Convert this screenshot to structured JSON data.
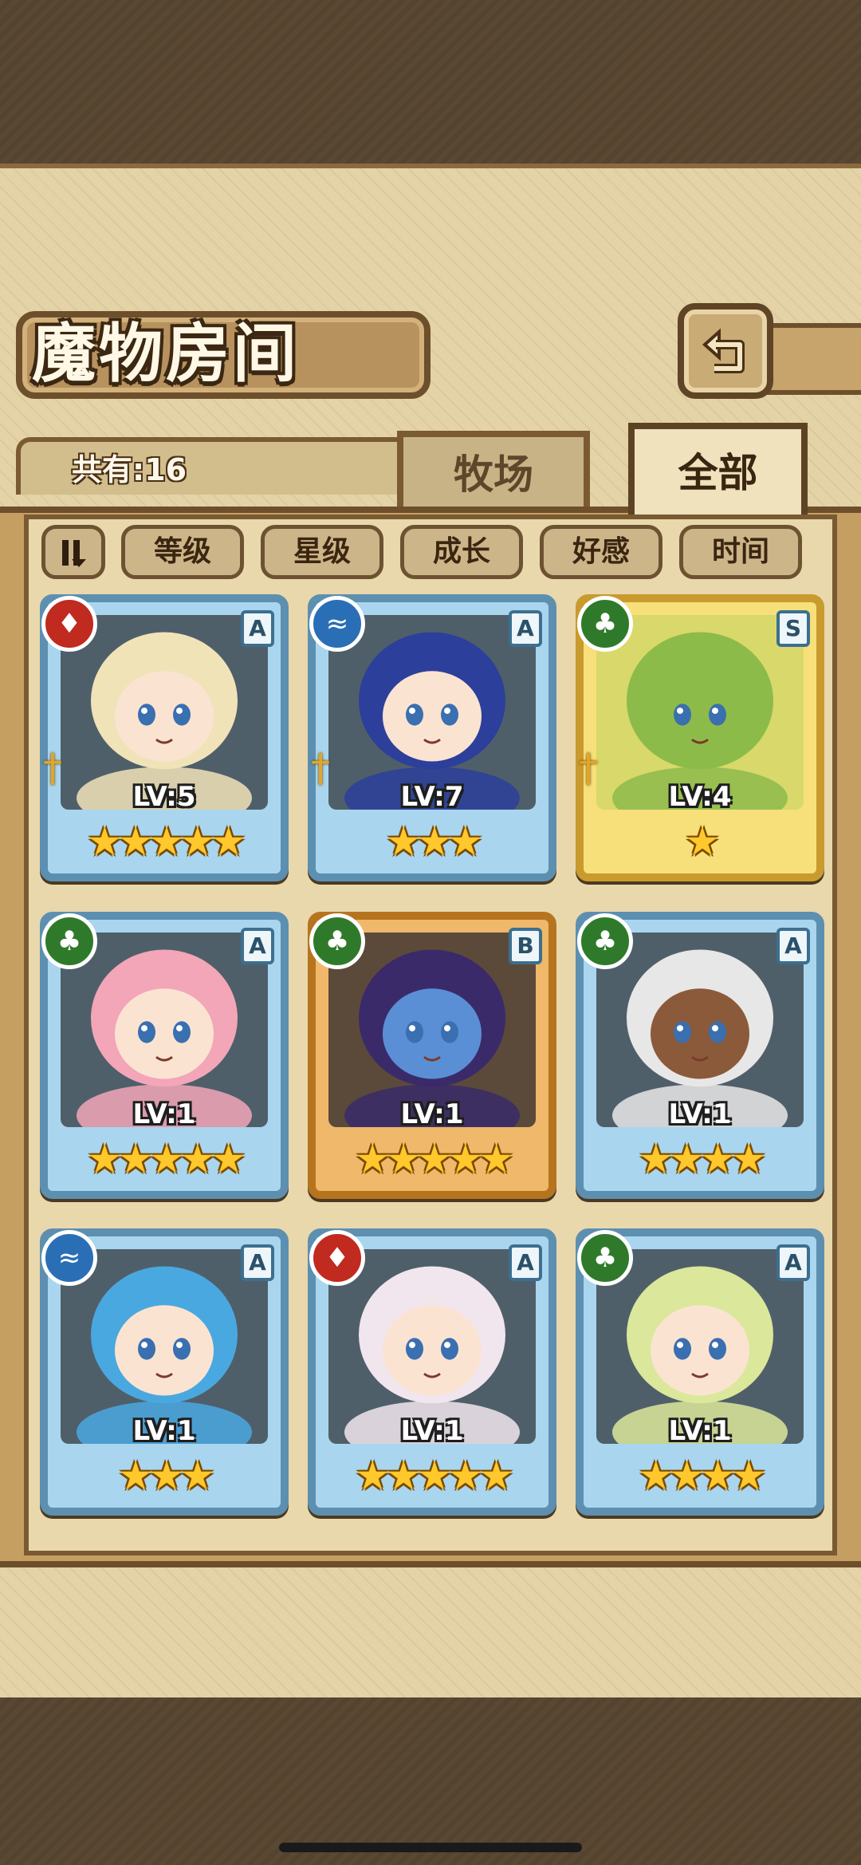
{
  "screen": {
    "title": "魔物房间",
    "count_label": "共有:16",
    "back_icon": "back-arrow-icon"
  },
  "tabs": [
    {
      "label": "牧场",
      "selected": false
    },
    {
      "label": "全部",
      "selected": true
    }
  ],
  "sort": {
    "toggle_icon": "sort-toggle-icon",
    "buttons": [
      "等级",
      "星级",
      "成长",
      "好感",
      "时间"
    ]
  },
  "colors": {
    "fire": "#c02a1f",
    "water": "#2a6fb6",
    "nature": "#2f7a2a",
    "frame_blue": "#5d8fb0",
    "frame_gold": "#c99a2e",
    "frame_bronze": "#b7741f"
  },
  "monsters": [
    {
      "level": "LV:5",
      "element": "fire",
      "rank": "A",
      "stars": 5,
      "frame": "blue",
      "weapon_icon": "sword-icon",
      "portrait_icon": "blonde-girl-portrait"
    },
    {
      "level": "LV:7",
      "element": "water",
      "rank": "A",
      "stars": 3,
      "frame": "blue",
      "weapon_icon": "sword-icon",
      "portrait_icon": "blue-cat-girl-portrait"
    },
    {
      "level": "LV:4",
      "element": "nature",
      "rank": "S",
      "stars": 1,
      "frame": "gold",
      "weapon_icon": "sword-icon",
      "portrait_icon": "green-slime-portrait"
    },
    {
      "level": "LV:1",
      "element": "nature",
      "rank": "A",
      "stars": 5,
      "frame": "blue",
      "weapon_icon": "",
      "portrait_icon": "pink-hair-girl-portrait"
    },
    {
      "level": "LV:1",
      "element": "nature",
      "rank": "B",
      "stars": 5,
      "frame": "bronze",
      "weapon_icon": "",
      "portrait_icon": "genie-girl-portrait"
    },
    {
      "level": "LV:1",
      "element": "nature",
      "rank": "A",
      "stars": 4,
      "frame": "blue",
      "weapon_icon": "",
      "portrait_icon": "owl-warrior-portrait"
    },
    {
      "level": "LV:1",
      "element": "water",
      "rank": "A",
      "stars": 3,
      "frame": "blue",
      "weapon_icon": "",
      "portrait_icon": "cow-girl-portrait"
    },
    {
      "level": "LV:1",
      "element": "fire",
      "rank": "A",
      "stars": 5,
      "frame": "blue",
      "weapon_icon": "",
      "portrait_icon": "horned-demon-girl-portrait"
    },
    {
      "level": "LV:1",
      "element": "nature",
      "rank": "A",
      "stars": 4,
      "frame": "blue",
      "weapon_icon": "",
      "portrait_icon": "fox-girl-glasses-portrait"
    }
  ]
}
